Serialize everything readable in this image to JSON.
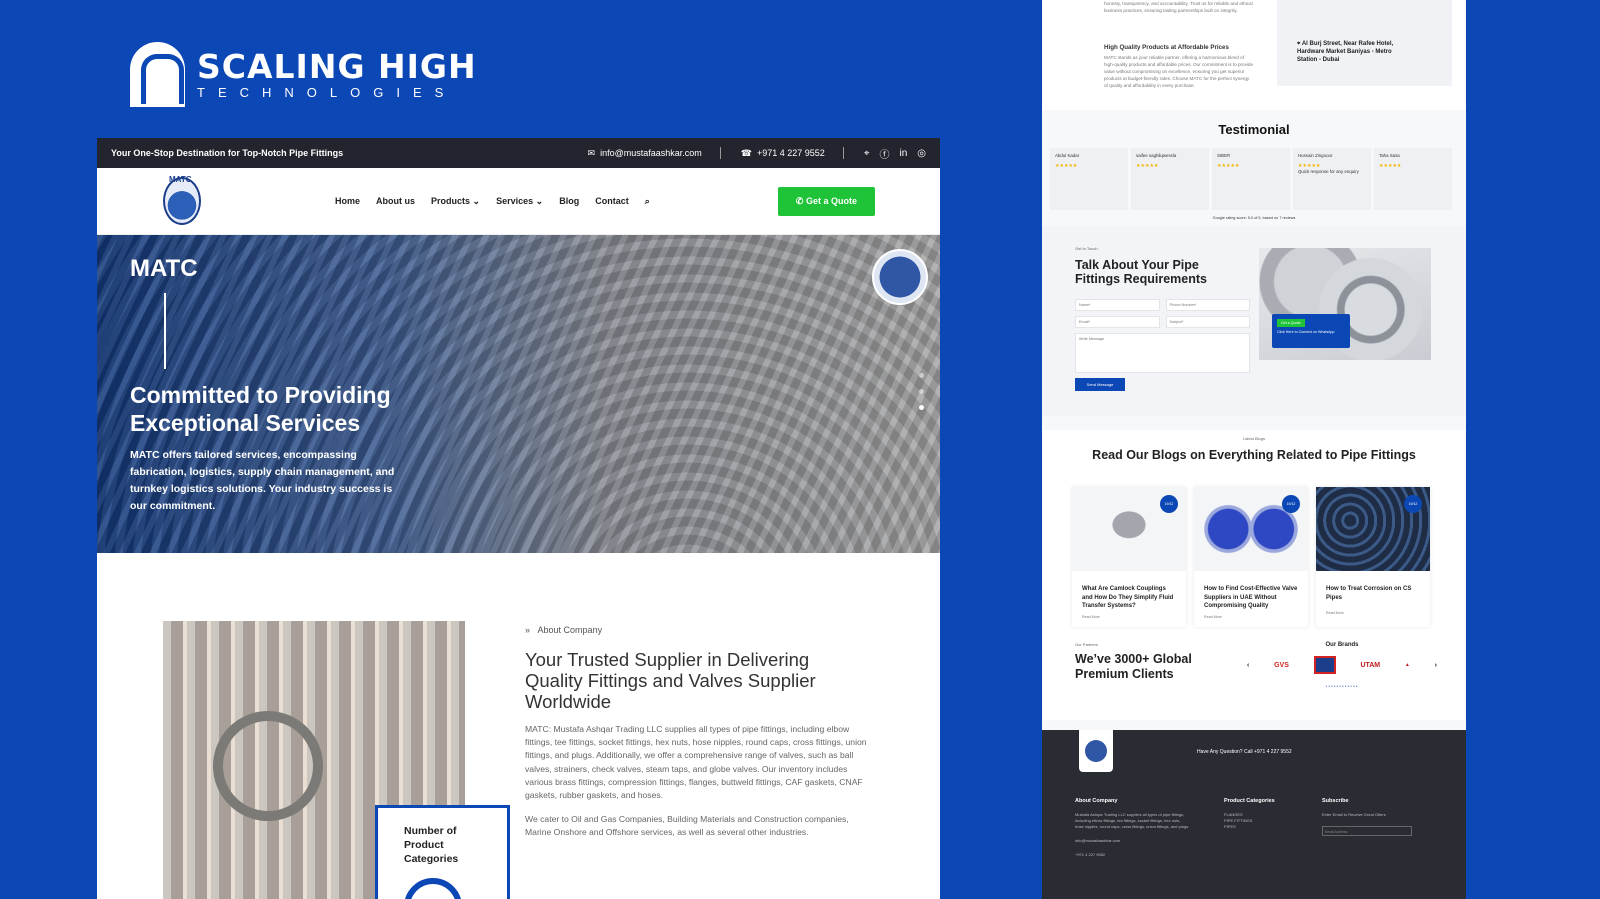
{
  "brand": {
    "title": "SCALING HIGH",
    "subtitle": "TECHNOLOGIES"
  },
  "colors": {
    "accent": "#0b47b5",
    "cta": "#1ec337",
    "dark": "#22252d"
  },
  "site": {
    "topbar": {
      "tagline": "Your One-Stop Destination for Top-Notch Pipe Fittings",
      "email": "info@mustafaashkar.com",
      "phone": "+971 4 227 9552",
      "social_icons": [
        "location-icon",
        "facebook-icon",
        "linkedin-icon",
        "instagram-icon"
      ]
    },
    "nav": {
      "logo_text": "MATC",
      "items": [
        "Home",
        "About us",
        "Products",
        "Services",
        "Blog",
        "Contact"
      ],
      "cta": "Get a Quote"
    },
    "hero": {
      "title": "MATC",
      "heading": "Committed to Providing Exceptional Services",
      "text": "MATC offers tailored services, encompassing fabrication, logistics, supply chain management, and turnkey logistics solutions. Your industry success is our commitment."
    },
    "about": {
      "kicker": "About Company",
      "heading": "Your Trusted Supplier in Delivering Quality Fittings and Valves Supplier Worldwide",
      "p1": "MATC: Mustafa Ashqar Trading LLC supplies all types of pipe fittings, including elbow fittings, tee fittings, socket fittings, hex nuts, hose nipples, round caps, cross fittings, union fittings, and plugs. Additionally, we offer a comprehensive range of valves, such as ball valves, strainers, check valves, steam taps, and globe valves. Our inventory includes various brass fittings, compression fittings, flanges, buttweld fittings, CAF gaskets, CNAF gaskets, rubber gaskets, and hoses.",
      "p2": "We cater to Oil and Gas Companies, Building Materials and Construction companies, Marine Onshore and Offshore services, as well as several other industries.",
      "stat_label": "Number of Product Categories"
    }
  },
  "page2": {
    "sec1": {
      "intro": "honesty, transparency, and accountability. Trust us for reliable and ethical business practices, ensuring lasting partnerships built on integrity.",
      "feature_title": "High Quality Products at Affordable Prices",
      "feature_text": "MATC stands as your reliable partner, offering a harmonious blend of high-quality products and affordable prices. Our commitment is to provide value without compromising on excellence, ensuring you get superior products at budget-friendly rates. Choose MATC for the perfect synergy of quality and affordability in every purchase.",
      "email": "info@mustafaashkar.com",
      "address": "Al Burj Street, Near Rafee Hotel, Hardware Market Baniyas - Metro Station - Dubai"
    },
    "testimonial": {
      "title": "Testimonial",
      "reviews": [
        {
          "name": "Abdul Kadar",
          "text": "",
          "stars": "★★★★★"
        },
        {
          "name": "saifee saghilqwessla",
          "text": "",
          "stars": "★★★★★"
        },
        {
          "name": "SIBER",
          "text": "",
          "stars": "★★★★★"
        },
        {
          "name": "Hussain Zingooor",
          "text": "Quick response for any enquiry",
          "stars": "★★★★★"
        },
        {
          "name": "Taha Sasa",
          "text": "",
          "stars": "★★★★★"
        }
      ],
      "google_note": "Google rating score: 5.0 of 5, based on 7 reviews"
    },
    "contact": {
      "kicker": "Get In Touch",
      "heading": "Talk About Your Pipe Fittings Requirements",
      "fields": {
        "name": "Name*",
        "phone": "Phone Number*",
        "email": "Email*",
        "subject": "Subject*",
        "message": "Write Message"
      },
      "send": "Send Message",
      "card_btn": "Get a Quote",
      "card_text": "Click Here to Connect on WhatsApp"
    },
    "blogs": {
      "kicker": "Latest Blogs",
      "heading": "Read Our Blogs on Everything Related to Pipe Fittings",
      "cards": [
        {
          "date": "19/12",
          "title": "What Are Camlock Couplings and How Do They Simplify Fluid Transfer Systems?",
          "more": "Read More"
        },
        {
          "date": "19/12",
          "title": "How to Find Cost-Effective Valve Suppliers in UAE Without Compromising Quality",
          "more": "Read More"
        },
        {
          "date": "19/12",
          "title": "How to Treat Corrosion on CS Pipes",
          "more": "Read More"
        }
      ],
      "partners_kicker": "Our Partners",
      "partners_heading": "We’ve 3000+ Global Premium Clients",
      "brands_title": "Our Brands",
      "brands": [
        "GVS",
        "UTAM"
      ]
    },
    "footer": {
      "question": "Have Any Question? Call  +971 4 227 9552",
      "about_title": "About Company",
      "about_text": "Mustafa Ashqar Trading LLC supplies all types of pipe fittings, including elbow fittings, tee fittings, socket fittings, hex nuts, hose nipples, round caps, cross fittings, union fittings, and plugs.",
      "email": "info@mustafaashkar.com",
      "phone": "+971 4 227 9552",
      "cat_title": "Product Categories",
      "cats": [
        "FLANGES",
        "PIPE FITTINGS",
        "PIPES"
      ],
      "sub_title": "Subscribe",
      "sub_text": "Enter Email to Receive Great Offers",
      "sub_placeholder": "Email Address"
    }
  }
}
